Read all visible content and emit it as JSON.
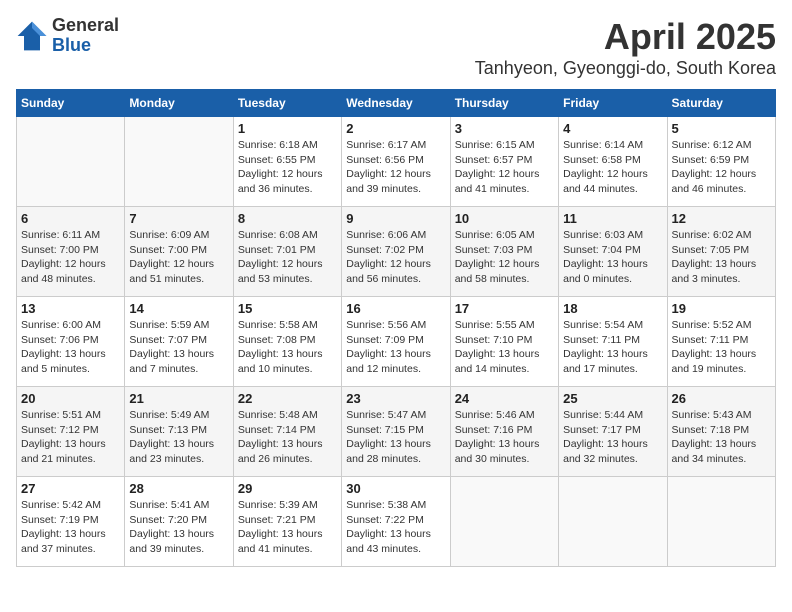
{
  "header": {
    "logo_general": "General",
    "logo_blue": "Blue",
    "month": "April 2025",
    "location": "Tanhyeon, Gyeonggi-do, South Korea"
  },
  "weekdays": [
    "Sunday",
    "Monday",
    "Tuesday",
    "Wednesday",
    "Thursday",
    "Friday",
    "Saturday"
  ],
  "weeks": [
    [
      {
        "day": "",
        "info": ""
      },
      {
        "day": "",
        "info": ""
      },
      {
        "day": "1",
        "info": "Sunrise: 6:18 AM\nSunset: 6:55 PM\nDaylight: 12 hours and 36 minutes."
      },
      {
        "day": "2",
        "info": "Sunrise: 6:17 AM\nSunset: 6:56 PM\nDaylight: 12 hours and 39 minutes."
      },
      {
        "day": "3",
        "info": "Sunrise: 6:15 AM\nSunset: 6:57 PM\nDaylight: 12 hours and 41 minutes."
      },
      {
        "day": "4",
        "info": "Sunrise: 6:14 AM\nSunset: 6:58 PM\nDaylight: 12 hours and 44 minutes."
      },
      {
        "day": "5",
        "info": "Sunrise: 6:12 AM\nSunset: 6:59 PM\nDaylight: 12 hours and 46 minutes."
      }
    ],
    [
      {
        "day": "6",
        "info": "Sunrise: 6:11 AM\nSunset: 7:00 PM\nDaylight: 12 hours and 48 minutes."
      },
      {
        "day": "7",
        "info": "Sunrise: 6:09 AM\nSunset: 7:00 PM\nDaylight: 12 hours and 51 minutes."
      },
      {
        "day": "8",
        "info": "Sunrise: 6:08 AM\nSunset: 7:01 PM\nDaylight: 12 hours and 53 minutes."
      },
      {
        "day": "9",
        "info": "Sunrise: 6:06 AM\nSunset: 7:02 PM\nDaylight: 12 hours and 56 minutes."
      },
      {
        "day": "10",
        "info": "Sunrise: 6:05 AM\nSunset: 7:03 PM\nDaylight: 12 hours and 58 minutes."
      },
      {
        "day": "11",
        "info": "Sunrise: 6:03 AM\nSunset: 7:04 PM\nDaylight: 13 hours and 0 minutes."
      },
      {
        "day": "12",
        "info": "Sunrise: 6:02 AM\nSunset: 7:05 PM\nDaylight: 13 hours and 3 minutes."
      }
    ],
    [
      {
        "day": "13",
        "info": "Sunrise: 6:00 AM\nSunset: 7:06 PM\nDaylight: 13 hours and 5 minutes."
      },
      {
        "day": "14",
        "info": "Sunrise: 5:59 AM\nSunset: 7:07 PM\nDaylight: 13 hours and 7 minutes."
      },
      {
        "day": "15",
        "info": "Sunrise: 5:58 AM\nSunset: 7:08 PM\nDaylight: 13 hours and 10 minutes."
      },
      {
        "day": "16",
        "info": "Sunrise: 5:56 AM\nSunset: 7:09 PM\nDaylight: 13 hours and 12 minutes."
      },
      {
        "day": "17",
        "info": "Sunrise: 5:55 AM\nSunset: 7:10 PM\nDaylight: 13 hours and 14 minutes."
      },
      {
        "day": "18",
        "info": "Sunrise: 5:54 AM\nSunset: 7:11 PM\nDaylight: 13 hours and 17 minutes."
      },
      {
        "day": "19",
        "info": "Sunrise: 5:52 AM\nSunset: 7:11 PM\nDaylight: 13 hours and 19 minutes."
      }
    ],
    [
      {
        "day": "20",
        "info": "Sunrise: 5:51 AM\nSunset: 7:12 PM\nDaylight: 13 hours and 21 minutes."
      },
      {
        "day": "21",
        "info": "Sunrise: 5:49 AM\nSunset: 7:13 PM\nDaylight: 13 hours and 23 minutes."
      },
      {
        "day": "22",
        "info": "Sunrise: 5:48 AM\nSunset: 7:14 PM\nDaylight: 13 hours and 26 minutes."
      },
      {
        "day": "23",
        "info": "Sunrise: 5:47 AM\nSunset: 7:15 PM\nDaylight: 13 hours and 28 minutes."
      },
      {
        "day": "24",
        "info": "Sunrise: 5:46 AM\nSunset: 7:16 PM\nDaylight: 13 hours and 30 minutes."
      },
      {
        "day": "25",
        "info": "Sunrise: 5:44 AM\nSunset: 7:17 PM\nDaylight: 13 hours and 32 minutes."
      },
      {
        "day": "26",
        "info": "Sunrise: 5:43 AM\nSunset: 7:18 PM\nDaylight: 13 hours and 34 minutes."
      }
    ],
    [
      {
        "day": "27",
        "info": "Sunrise: 5:42 AM\nSunset: 7:19 PM\nDaylight: 13 hours and 37 minutes."
      },
      {
        "day": "28",
        "info": "Sunrise: 5:41 AM\nSunset: 7:20 PM\nDaylight: 13 hours and 39 minutes."
      },
      {
        "day": "29",
        "info": "Sunrise: 5:39 AM\nSunset: 7:21 PM\nDaylight: 13 hours and 41 minutes."
      },
      {
        "day": "30",
        "info": "Sunrise: 5:38 AM\nSunset: 7:22 PM\nDaylight: 13 hours and 43 minutes."
      },
      {
        "day": "",
        "info": ""
      },
      {
        "day": "",
        "info": ""
      },
      {
        "day": "",
        "info": ""
      }
    ]
  ]
}
